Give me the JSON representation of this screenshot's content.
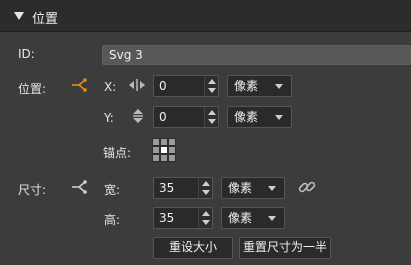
{
  "section": {
    "title": "位置"
  },
  "id_row": {
    "label": "ID:",
    "value": "Svg 3"
  },
  "position": {
    "label": "位置:",
    "x": {
      "label": "X:",
      "value": "0",
      "unit": "像素"
    },
    "y": {
      "label": "Y:",
      "value": "0",
      "unit": "像素"
    },
    "anchor_label": "锚点:"
  },
  "size": {
    "label": "尺寸:",
    "width": {
      "label": "宽:",
      "value": "35",
      "unit": "像素"
    },
    "height": {
      "label": "高:",
      "value": "35",
      "unit": "像素"
    },
    "reset_button": "重设大小",
    "half_button": "重置尺寸为一半"
  },
  "colors": {
    "accent": "#e8891f",
    "panel": "#3c3c3c",
    "header": "#2c2c2c"
  }
}
